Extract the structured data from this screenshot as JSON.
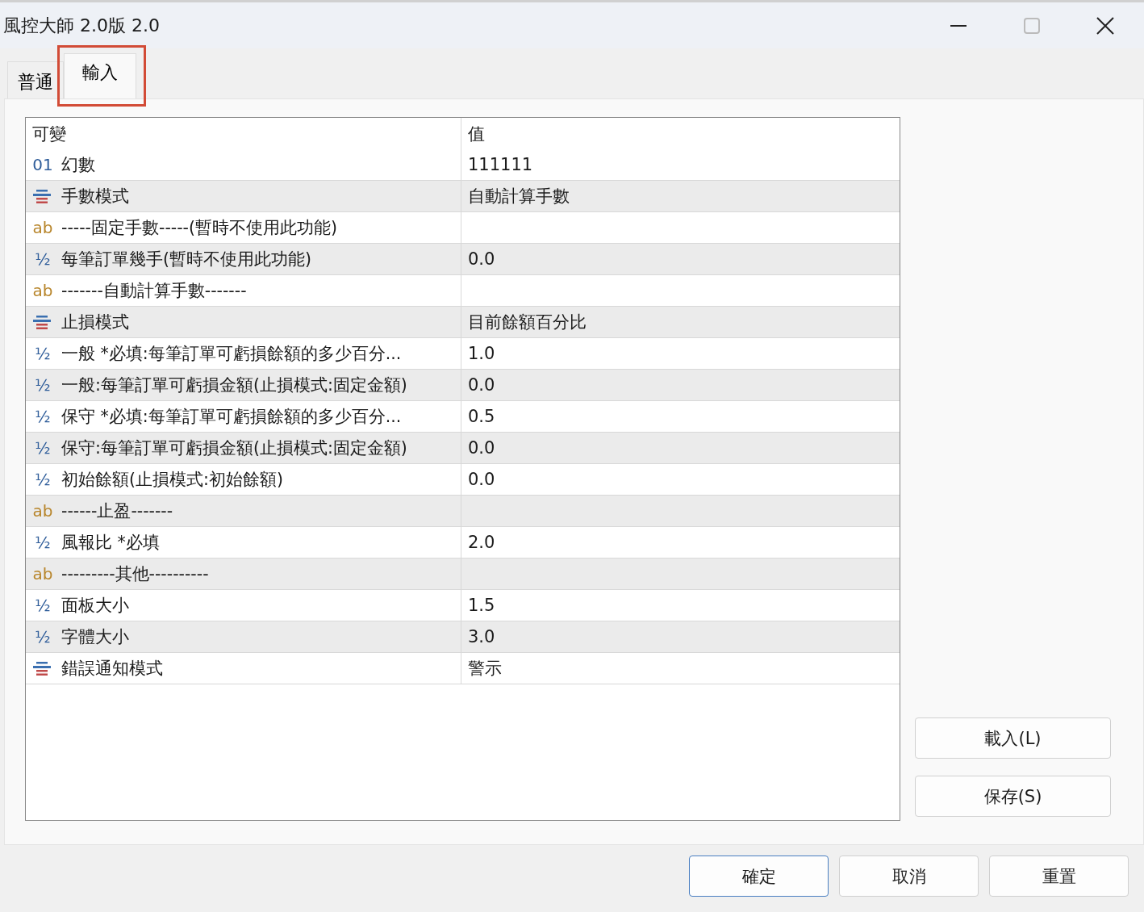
{
  "window": {
    "title": "風控大師 2.0版 2.0"
  },
  "tabs": [
    {
      "label": "普通",
      "selected": false,
      "highlighted": false
    },
    {
      "label": "輸入",
      "selected": true,
      "highlighted": true
    }
  ],
  "table": {
    "columns": [
      "可變",
      "值"
    ],
    "rows": [
      {
        "kind": "int",
        "icon": "01",
        "name": "幻數",
        "value": "111111"
      },
      {
        "kind": "enum",
        "name": "手數模式",
        "value": "自動計算手數"
      },
      {
        "kind": "string",
        "icon": "ab",
        "name": "-----固定手數-----(暫時不使用此功能)"
      },
      {
        "kind": "double",
        "icon": "½",
        "name": "每筆訂單幾手(暫時不使用此功能)",
        "value": "0.0"
      },
      {
        "kind": "string",
        "icon": "ab",
        "name": "-------自動計算手數-------"
      },
      {
        "kind": "enum",
        "name": "止損模式",
        "value": "目前餘額百分比"
      },
      {
        "kind": "double",
        "icon": "½",
        "name": "一般 *必填:每筆訂單可虧損餘額的多少百分...",
        "value": "1.0"
      },
      {
        "kind": "double",
        "icon": "½",
        "name": "一般:每筆訂單可虧損金額(止損模式:固定金額)",
        "value": "0.0"
      },
      {
        "kind": "double",
        "icon": "½",
        "name": "保守 *必填:每筆訂單可虧損餘額的多少百分...",
        "value": "0.5"
      },
      {
        "kind": "double",
        "icon": "½",
        "name": "保守:每筆訂單可虧損金額(止損模式:固定金額)",
        "value": "0.0"
      },
      {
        "kind": "double",
        "icon": "½",
        "name": "初始餘額(止損模式:初始餘額)",
        "value": "0.0"
      },
      {
        "kind": "string",
        "icon": "ab",
        "name": "------止盈-------"
      },
      {
        "kind": "double",
        "icon": "½",
        "name": "風報比 *必填",
        "value": "2.0"
      },
      {
        "kind": "string",
        "icon": "ab",
        "name": "---------其他----------"
      },
      {
        "kind": "double",
        "icon": "½",
        "name": "面板大小",
        "value": "1.5"
      },
      {
        "kind": "double",
        "icon": "½",
        "name": "字體大小",
        "value": "3.0"
      },
      {
        "kind": "enum",
        "name": "錯誤通知模式",
        "value": "警示"
      }
    ]
  },
  "side_buttons": [
    "載入(L)",
    "保存(S)"
  ],
  "buttons": [
    {
      "label": "確定",
      "default": true
    },
    {
      "label": "取消",
      "default": false
    },
    {
      "label": "重置",
      "default": false
    }
  ]
}
